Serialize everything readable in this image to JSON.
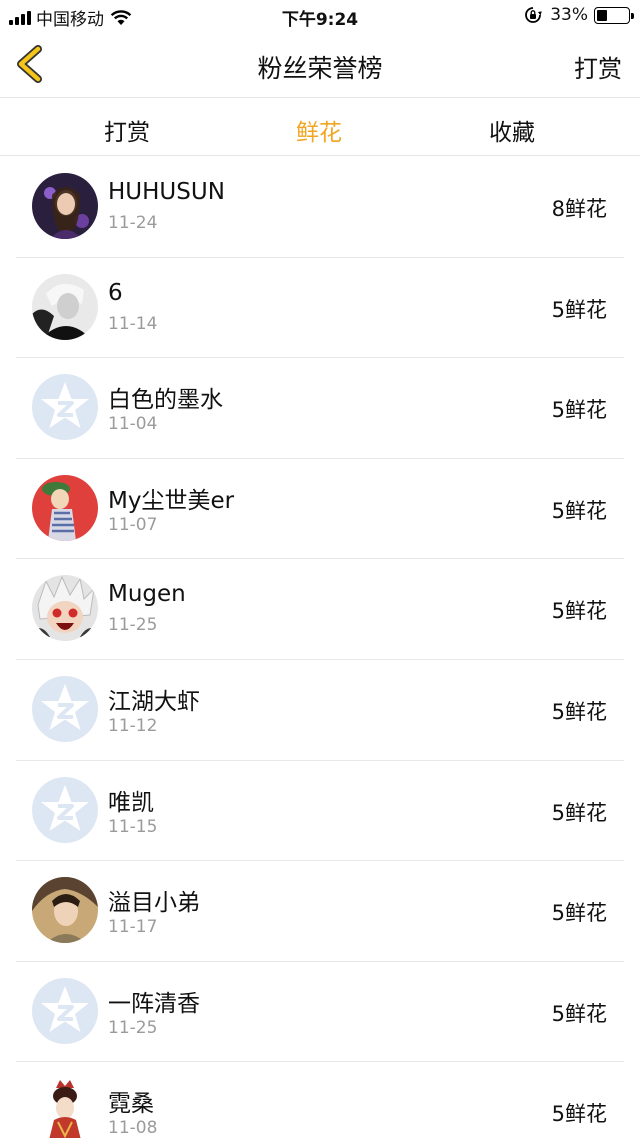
{
  "status_bar": {
    "carrier": "中国移动",
    "time": "下午9:24",
    "battery": "33%",
    "icons": [
      "signal-icon",
      "wifi-icon",
      "rotation-lock-icon",
      "battery-icon"
    ]
  },
  "nav": {
    "back_icon": "chevron-left-icon",
    "title": "粉丝荣誉榜",
    "action": "打赏"
  },
  "tabs": [
    {
      "label": "打赏",
      "active": false
    },
    {
      "label": "鲜花",
      "active": true
    },
    {
      "label": "收藏",
      "active": false
    }
  ],
  "colors": {
    "accent": "#f0a623",
    "default_avatar": "#dde7f3"
  },
  "rows": [
    {
      "name": "HUHUSUN",
      "date": "11-24",
      "count": "8鲜花",
      "avatar": "photo"
    },
    {
      "name": "6",
      "date": "11-14",
      "count": "5鲜花",
      "avatar": "photo"
    },
    {
      "name": "白色的墨水",
      "date": "11-04",
      "count": "5鲜花",
      "avatar": "default"
    },
    {
      "name": "My尘世美er",
      "date": "11-07",
      "count": "5鲜花",
      "avatar": "photo"
    },
    {
      "name": "Mugen",
      "date": "11-25",
      "count": "5鲜花",
      "avatar": "photo"
    },
    {
      "name": "江湖大虾",
      "date": "11-12",
      "count": "5鲜花",
      "avatar": "default"
    },
    {
      "name": "唯凯",
      "date": "11-15",
      "count": "5鲜花",
      "avatar": "default"
    },
    {
      "name": "溢目小弟",
      "date": "11-17",
      "count": "5鲜花",
      "avatar": "photo"
    },
    {
      "name": "一阵清香",
      "date": "11-25",
      "count": "5鲜花",
      "avatar": "default"
    },
    {
      "name": "霓桑",
      "date": "11-08",
      "count": "5鲜花",
      "avatar": "photo"
    }
  ]
}
